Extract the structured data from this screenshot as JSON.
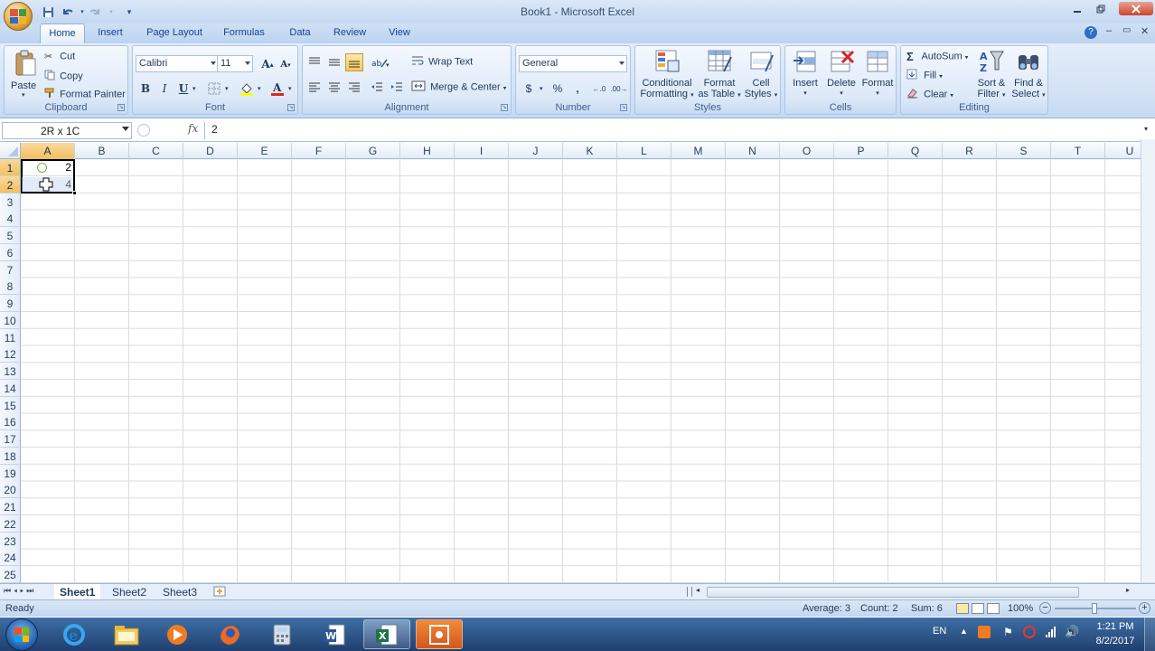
{
  "window": {
    "title": "Book1 - Microsoft Excel"
  },
  "tabs": [
    "Home",
    "Insert",
    "Page Layout",
    "Formulas",
    "Data",
    "Review",
    "View"
  ],
  "clipboard": {
    "paste": "Paste",
    "cut": "Cut",
    "copy": "Copy",
    "format_painter": "Format Painter",
    "label": "Clipboard"
  },
  "font": {
    "name": "Calibri",
    "size": "11",
    "bold": "B",
    "italic": "I",
    "underline": "U",
    "label": "Font"
  },
  "alignment": {
    "wrap_text": "Wrap Text",
    "merge_center": "Merge & Center",
    "label": "Alignment"
  },
  "number": {
    "format": "General",
    "currency": "$",
    "percent": "%",
    "comma": ",",
    "label": "Number"
  },
  "styles": {
    "conditional_1": "Conditional",
    "conditional_2": "Formatting",
    "format_table_1": "Format",
    "format_table_2": "as Table",
    "cell_styles_1": "Cell",
    "cell_styles_2": "Styles",
    "label": "Styles"
  },
  "cells_group": {
    "insert": "Insert",
    "delete": "Delete",
    "format": "Format",
    "label": "Cells"
  },
  "editing": {
    "autosum": "AutoSum",
    "fill": "Fill",
    "clear": "Clear",
    "sort_1": "Sort &",
    "sort_2": "Filter",
    "find_1": "Find &",
    "find_2": "Select",
    "label": "Editing"
  },
  "formula_bar": {
    "name_box": "2R x 1C",
    "fx": "fx",
    "value": "2"
  },
  "columns": [
    "A",
    "B",
    "C",
    "D",
    "E",
    "F",
    "G",
    "H",
    "I",
    "J",
    "K",
    "L",
    "M",
    "N",
    "O",
    "P",
    "Q",
    "R",
    "S",
    "T",
    "U"
  ],
  "rows": [
    "1",
    "2",
    "3",
    "4",
    "5",
    "6",
    "7",
    "8",
    "9",
    "10",
    "11",
    "12",
    "13",
    "14",
    "15",
    "16",
    "17",
    "18",
    "19",
    "20",
    "21",
    "22",
    "23",
    "24",
    "25"
  ],
  "cell_values": {
    "A1": "2",
    "A2": "4"
  },
  "sheets": [
    "Sheet1",
    "Sheet2",
    "Sheet3"
  ],
  "status": {
    "ready": "Ready",
    "average": "Average: 3",
    "count": "Count: 2",
    "sum": "Sum: 6",
    "zoom": "100%"
  },
  "taskbar": {
    "lang": "EN",
    "time": "1:21 PM",
    "date": "8/2/2017"
  },
  "colors": {
    "accent": "#15428b",
    "selection_header": "#f1c05c",
    "grid": "#dadcdd"
  }
}
